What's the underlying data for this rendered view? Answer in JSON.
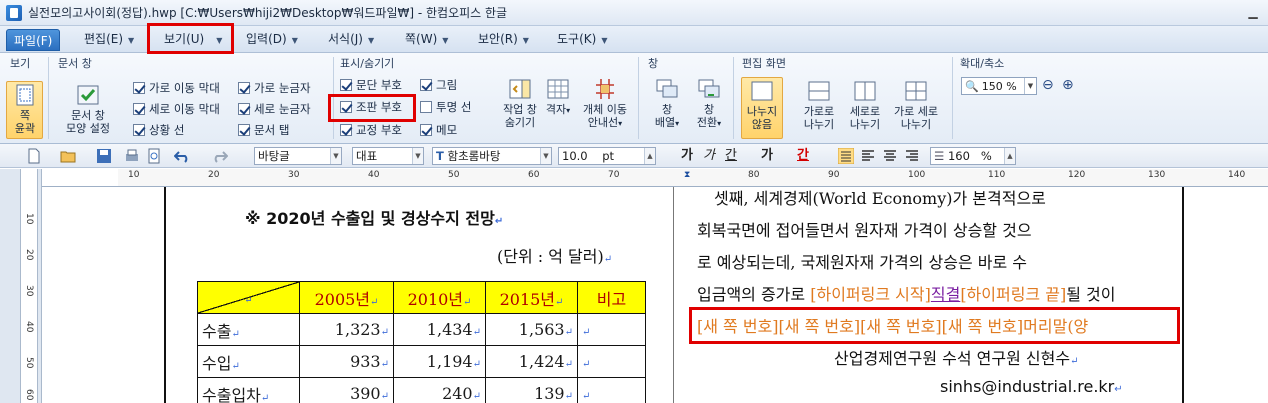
{
  "window": {
    "title": "실전모의고사이회(정답).hwp  [C:₩Users₩hiji2₩Desktop₩워드파일₩] - 한컴오피스 한글"
  },
  "menu": {
    "file": "파일(F)",
    "edit": "편집(E)",
    "view": "보기(U)",
    "insert": "입력(D)",
    "format": "서식(J)",
    "page": "쪽(W)",
    "security": "보안(R)",
    "tools": "도구(K)"
  },
  "ribbon": {
    "group_view": "보기",
    "group_docwin": "문서 창",
    "group_showhide": "표시/숨기기",
    "group_window": "창",
    "group_editscreen": "편집 화면",
    "group_zoom": "확대/축소",
    "page_outline": [
      "쪽",
      "윤곽"
    ],
    "docwin_settings": [
      "문서 창",
      "모양 설정"
    ],
    "checkboxes": {
      "hscroll": "가로 이동 막대",
      "hruler": "가로 눈금자",
      "vscroll": "세로 이동 막대",
      "vruler": "세로 눈금자",
      "statusbar": "상황 선",
      "doctab": "문서 탭",
      "para_mark": "문단 부호",
      "picture": "그림",
      "ctrl_mark": "조판 부호",
      "transparent_line": "투명 선",
      "revision_mark": "교정 부호",
      "memo": "메모"
    },
    "hide_work_window": [
      "작업 창",
      "숨기기"
    ],
    "grid": [
      "격자",
      ""
    ],
    "object_move_guide": [
      "개체 이동",
      "안내선"
    ],
    "window_arrange": [
      "창",
      "배열"
    ],
    "window_switch": [
      "창",
      "전환"
    ],
    "no_split": [
      "나누지",
      "않음"
    ],
    "split_horizontal": [
      "가로로",
      "나누기"
    ],
    "split_vertical": [
      "세로로",
      "나누기"
    ],
    "split_both": [
      "가로 세로",
      "나누기"
    ],
    "zoom_value": "150 %"
  },
  "toolbar": {
    "style": "바탕글",
    "language": "대표",
    "font": "함초롬바탕",
    "font_size": "10.0",
    "font_unit": "pt",
    "bold": "가",
    "italic": "가",
    "underline": "간",
    "strike": "가",
    "color": "간",
    "line_spacing": "160",
    "line_spacing_unit": "%"
  },
  "ruler": {
    "numbers": [
      "10",
      "20",
      "30",
      "40",
      "50",
      "60",
      "70",
      "80",
      "90",
      "100",
      "110",
      "120",
      "130",
      "140",
      "150"
    ]
  },
  "vruler_numbers": [
    "10",
    "20",
    "30",
    "40",
    "50",
    "60"
  ],
  "document": {
    "left_title": "※ 2020년 수출입 및 경상수지 전망",
    "unit_note": "(단위 : 억 달러)",
    "table": {
      "header": [
        "",
        "2005년",
        "2010년",
        "2015년",
        "비고"
      ],
      "rows": [
        {
          "label": "수출",
          "v1": "1,323",
          "v2": "1,434",
          "v3": "1,563"
        },
        {
          "label": "수입",
          "v1": "933",
          "v2": "1,194",
          "v3": "1,424"
        },
        {
          "label": "수출입차",
          "v1": "390",
          "v2": "240",
          "v3": "139"
        }
      ]
    },
    "right_lines": [
      "셋째, 세계경제(World Economy)가 본격적으로",
      "회복국면에 접어들면서 원자재 가격이 상승할 것으",
      "로 예상되는데, 국제원자재 가격의 상승은 바로 수"
    ],
    "line4_prefix": "입금액의 증가로",
    "hyperlink_start": "[하이퍼링크 시작]",
    "hyperlink_text": "직결",
    "hyperlink_end": "[하이퍼링크 끝]",
    "line4_suffix": "될 것이",
    "new_page_codes": "[새 쪽 번호][새 쪽 번호][새 쪽 번호][새 쪽 번호]",
    "header_code": "머리말(양",
    "author": "산업경제연구원 수석 연구원 신현수",
    "email": "sinhs@industrial.re.kr"
  }
}
